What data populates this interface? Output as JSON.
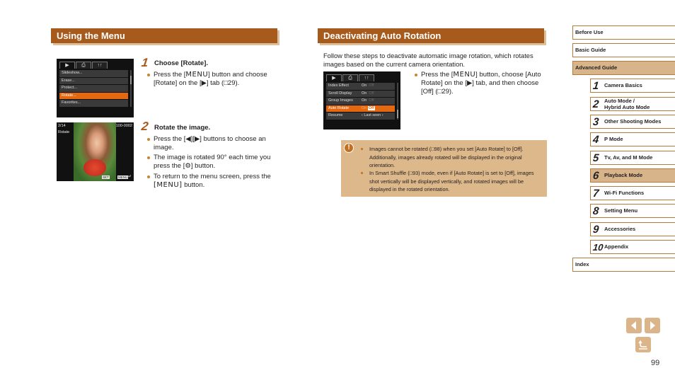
{
  "left_section": {
    "title": "Using the Menu",
    "menu_screen": {
      "tabs": [
        "playback-tab",
        "print-tab",
        "setup-tab"
      ],
      "items": [
        "Slideshow...",
        "Erase...",
        "Protect...",
        "Rotate...",
        "Favorites..."
      ],
      "selected_index": 3
    },
    "playback_screen": {
      "counter": "2/14",
      "label": "Rotate",
      "file_no": "100-0002",
      "set_label": "SET",
      "menu_label": "MENU"
    },
    "steps": [
      {
        "number": "1",
        "title": "Choose [Rotate].",
        "bullets": [
          {
            "pre": "Press the [",
            "key": "MENU",
            "post": "] button and choose [Rotate] on the [▶] tab (□29)."
          }
        ]
      },
      {
        "number": "2",
        "title": "Rotate the image.",
        "bullets": [
          {
            "text": "Press the [◀][▶] buttons to choose an image."
          },
          {
            "text": "The image is rotated 90° each time you press the [⚙] button."
          },
          {
            "pre": "To return to the menu screen, press the ",
            "key": "[MENU]",
            "post": " button."
          }
        ]
      }
    ]
  },
  "right_section": {
    "title": "Deactivating Auto Rotation",
    "intro": "Follow these steps to deactivate automatic image rotation, which rotates images based on the current camera orientation.",
    "menu_screen": {
      "tabs": [
        "playback-tab",
        "print-tab",
        "setup-tab"
      ],
      "rows": [
        {
          "label": "Index Effect",
          "value": "On",
          "alt": "Off"
        },
        {
          "label": "Scroll Display",
          "value": "On",
          "alt": "Off"
        },
        {
          "label": "Group Images",
          "value": "On",
          "alt": "Off"
        },
        {
          "label": "Auto Rotate",
          "value": "On",
          "alt": "Off"
        },
        {
          "label": "Resume",
          "value": "‹ Last seen ›",
          "alt": ""
        }
      ],
      "selected_index": 3
    },
    "bullet": {
      "pre": "Press the [",
      "key": "MENU",
      "post": "] button, choose [Auto Rotate] on the [▶] tab, and then choose [Off] (□29)."
    },
    "caution": {
      "icon": "caution-icon",
      "bullets": [
        "Images cannot be rotated (□98) when you set [Auto Rotate] to [Off]. Additionally, images already rotated will be displayed in the original orientation.",
        "In Smart Shuffle (□93) mode, even if [Auto Rotate] is set to [Off], images shot vertically will be displayed vertically, and rotated images will be displayed in the rotated orientation."
      ]
    }
  },
  "sidebar": {
    "sections": [
      {
        "label": "Before Use",
        "active": false
      },
      {
        "label": "Basic Guide",
        "active": false
      },
      {
        "label": "Advanced Guide",
        "active": true
      }
    ],
    "chapters": [
      {
        "num": "1",
        "label": "Camera Basics",
        "active": false
      },
      {
        "num": "2",
        "label": "Auto Mode /",
        "label2": "Hybrid Auto Mode",
        "active": false
      },
      {
        "num": "3",
        "label": "Other Shooting Modes",
        "active": false
      },
      {
        "num": "4",
        "label": "P Mode",
        "active": false
      },
      {
        "num": "5",
        "label": "Tv, Av, and M Mode",
        "active": false
      },
      {
        "num": "6",
        "label": "Playback Mode",
        "active": true
      },
      {
        "num": "7",
        "label": "Wi-Fi Functions",
        "active": false
      },
      {
        "num": "8",
        "label": "Setting Menu",
        "active": false
      },
      {
        "num": "9",
        "label": "Accessories",
        "active": false
      },
      {
        "num": "10",
        "label": "Appendix",
        "active": false
      }
    ],
    "index_label": "Index"
  },
  "navigation": {
    "prev": "◀",
    "next": "▶",
    "back": "↵",
    "page_number": "99"
  },
  "colors": {
    "header_brown": "#a65a1c",
    "nav_highlight": "#d8b48a",
    "caution_bg": "#dcb88b",
    "menu_select_orange": "#e3680f"
  }
}
